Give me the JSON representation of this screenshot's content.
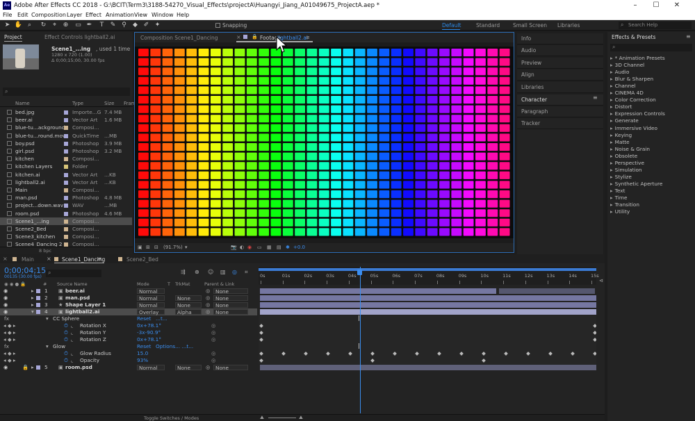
{
  "title": "Adobe After Effects CC 2018 - G:\\BCIT\\Term3\\3188-54270_Visual_Effects\\projectA\\Huangyi_Jiang_A01049675_ProjectA.aep *",
  "app_badge": "Ae",
  "window_controls": [
    "–",
    "☐",
    "✕"
  ],
  "menu": [
    "File",
    "Edit",
    "Composition",
    "Layer",
    "Effect",
    "Animation",
    "View",
    "Window",
    "Help"
  ],
  "toolbar": {
    "snapping": "Snapping",
    "workspaces": [
      "Default",
      "Standard",
      "Small Screen",
      "Libraries"
    ],
    "active_workspace": "Default",
    "search_placeholder": "Search Help"
  },
  "project": {
    "tab": "Project",
    "effect_controls_tab": "Effect Controls lightball2.ai",
    "thumb_name": "Scene1_...ing",
    "thumb_used": ", used 1 time",
    "thumb_size": "1280 x 720 (1.00)",
    "thumb_dur": "Δ 0;00;15;00, 30.00 fps",
    "columns": [
      "Name",
      "Type",
      "Size",
      "Fram"
    ],
    "items": [
      {
        "name": "bed.jpg",
        "type": "Importe...G",
        "size": "7.4 MB",
        "color": "#a7a7d8",
        "icon": "image-icon"
      },
      {
        "name": "beer.ai",
        "type": "Vector Art",
        "size": "1.6 MB",
        "color": "#a7a7d8",
        "icon": "vector-icon"
      },
      {
        "name": "blue-tu...ackground",
        "type": "Composi...",
        "size": "",
        "color": "#cfb591",
        "icon": "composition-icon"
      },
      {
        "name": "blue-tu...round.mov",
        "type": "QuickTime",
        "size": "...MB",
        "color": "#a7a7d8",
        "icon": "video-icon"
      },
      {
        "name": "boy.psd",
        "type": "Photoshop",
        "size": "3.9 MB",
        "color": "#a7a7d8",
        "icon": "psd-icon"
      },
      {
        "name": "girl.psd",
        "type": "Photoshop",
        "size": "3.2 MB",
        "color": "#a7a7d8",
        "icon": "psd-icon"
      },
      {
        "name": "kitchen",
        "type": "Composi...",
        "size": "",
        "color": "#cfb591",
        "icon": "composition-icon"
      },
      {
        "name": "kitchen Layers",
        "type": "Folder",
        "size": "",
        "color": "#d8c478",
        "icon": "folder-icon"
      },
      {
        "name": "kitchen.ai",
        "type": "Vector Art",
        "size": "...KB",
        "color": "#a7a7d8",
        "icon": "vector-icon"
      },
      {
        "name": "lightball2.ai",
        "type": "Vector Art",
        "size": "...KB",
        "color": "#a7a7d8",
        "icon": "vector-icon"
      },
      {
        "name": "Main",
        "type": "Composi...",
        "size": "",
        "color": "#cfb591",
        "icon": "composition-icon"
      },
      {
        "name": "man.psd",
        "type": "Photoshop",
        "size": "4.8 MB",
        "color": "#a7a7d8",
        "icon": "psd-icon"
      },
      {
        "name": "project...down.wav",
        "type": "WAV",
        "size": "...MB",
        "color": "#a7a7d8",
        "icon": "audio-icon"
      },
      {
        "name": "room.psd",
        "type": "Photoshop",
        "size": "4.6 MB",
        "color": "#a7a7d8",
        "icon": "psd-icon"
      },
      {
        "name": "Scene1_...ing",
        "type": "Composi...",
        "size": "",
        "color": "#cfb591",
        "icon": "composition-icon",
        "selected": true
      },
      {
        "name": "Scene2_Bed",
        "type": "Composi...",
        "size": "",
        "color": "#cfb591",
        "icon": "composition-icon"
      },
      {
        "name": "Scene3_kitchen",
        "type": "Composi...",
        "size": "",
        "color": "#cfb591",
        "icon": "composition-icon"
      },
      {
        "name": "Scene4_Dancing 2",
        "type": "Composi...",
        "size": "",
        "color": "#cfb591",
        "icon": "composition-icon"
      }
    ],
    "bpc": "8 bpc"
  },
  "viewer": {
    "tab_comp": "Composition Scene1_Dancing",
    "tab_footage_prefix": "Footage ",
    "tab_footage_name": "lightball2.ai",
    "zoom": "(91.7%)",
    "offset": "+0.0",
    "grid_cols": 31,
    "grid_rows": 20
  },
  "right_panels": [
    "Info",
    "Audio",
    "Preview",
    "Align",
    "Libraries",
    "Character",
    "Paragraph",
    "Tracker"
  ],
  "effects_presets": {
    "title": "Effects & Presets",
    "items": [
      "* Animation Presets",
      "3D Channel",
      "Audio",
      "Blur & Sharpen",
      "Channel",
      "CINEMA 4D",
      "Color Correction",
      "Distort",
      "Expression Controls",
      "Generate",
      "Immersive Video",
      "Keying",
      "Matte",
      "Noise & Grain",
      "Obsolete",
      "Perspective",
      "Simulation",
      "Stylize",
      "Synthetic Aperture",
      "Text",
      "Time",
      "Transition",
      "Utility"
    ]
  },
  "timeline": {
    "tabs": [
      "Main",
      "Scene1_Dancing",
      "Scene2_Bed"
    ],
    "active_tab": "Scene1_Dancing",
    "timecode": "0;00;04;15",
    "frames": "00135 (30.00 fps)",
    "columns": {
      "hash": "#",
      "source": "Source Name",
      "mode": "Mode",
      "t": "T",
      "trkmat": "TrkMat",
      "parent": "Parent & Link"
    },
    "ruler": [
      "0s",
      "01s",
      "02s",
      "03s",
      "04s",
      "05s",
      "06s",
      "07s",
      "08s",
      "09s",
      "10s",
      "11s",
      "12s",
      "13s",
      "14s",
      "15s"
    ],
    "playhead_seconds": 4.5,
    "duration_seconds": 15,
    "layers": [
      {
        "num": "1",
        "name": "beer.ai",
        "mode": "Normal",
        "trkmat": "",
        "parent": "None",
        "color": "#a7a7d8",
        "icon": "vector-icon"
      },
      {
        "num": "2",
        "name": "man.psd",
        "mode": "Normal",
        "trkmat": "None",
        "parent": "None",
        "color": "#a7a7d8",
        "icon": "psd-icon"
      },
      {
        "num": "3",
        "name": "Shape Layer 1",
        "mode": "Normal",
        "trkmat": "None",
        "parent": "None",
        "color": "#a7a7d8",
        "icon": "shape-star-icon"
      },
      {
        "num": "4",
        "name": "lightball2.ai",
        "mode": "Overlay",
        "trkmat": "Alpha",
        "parent": "None",
        "color": "#a7a7d8",
        "icon": "vector-icon",
        "selected": true
      }
    ],
    "effects": [
      {
        "kind": "effect",
        "name": "CC Sphere",
        "reset": "Reset",
        "extra": "...t..."
      },
      {
        "kind": "prop",
        "name": "Rotation X",
        "value": "0x+78.1°"
      },
      {
        "kind": "prop",
        "name": "Rotation Y",
        "value": "-3x-90.9°"
      },
      {
        "kind": "prop",
        "name": "Rotation Z",
        "value": "0x+78.1°"
      },
      {
        "kind": "effect",
        "name": "Glow",
        "reset": "Reset",
        "extra": "Options...   ...t..."
      },
      {
        "kind": "prop",
        "name": "Glow Radius",
        "value": "15.0"
      },
      {
        "kind": "prop",
        "name": "Opacity",
        "value": "93%"
      }
    ],
    "layer5": {
      "num": "5",
      "name": "room.psd",
      "mode": "Normal",
      "trkmat": "None",
      "parent": "None"
    },
    "toggle": "Toggle Switches / Modes"
  }
}
